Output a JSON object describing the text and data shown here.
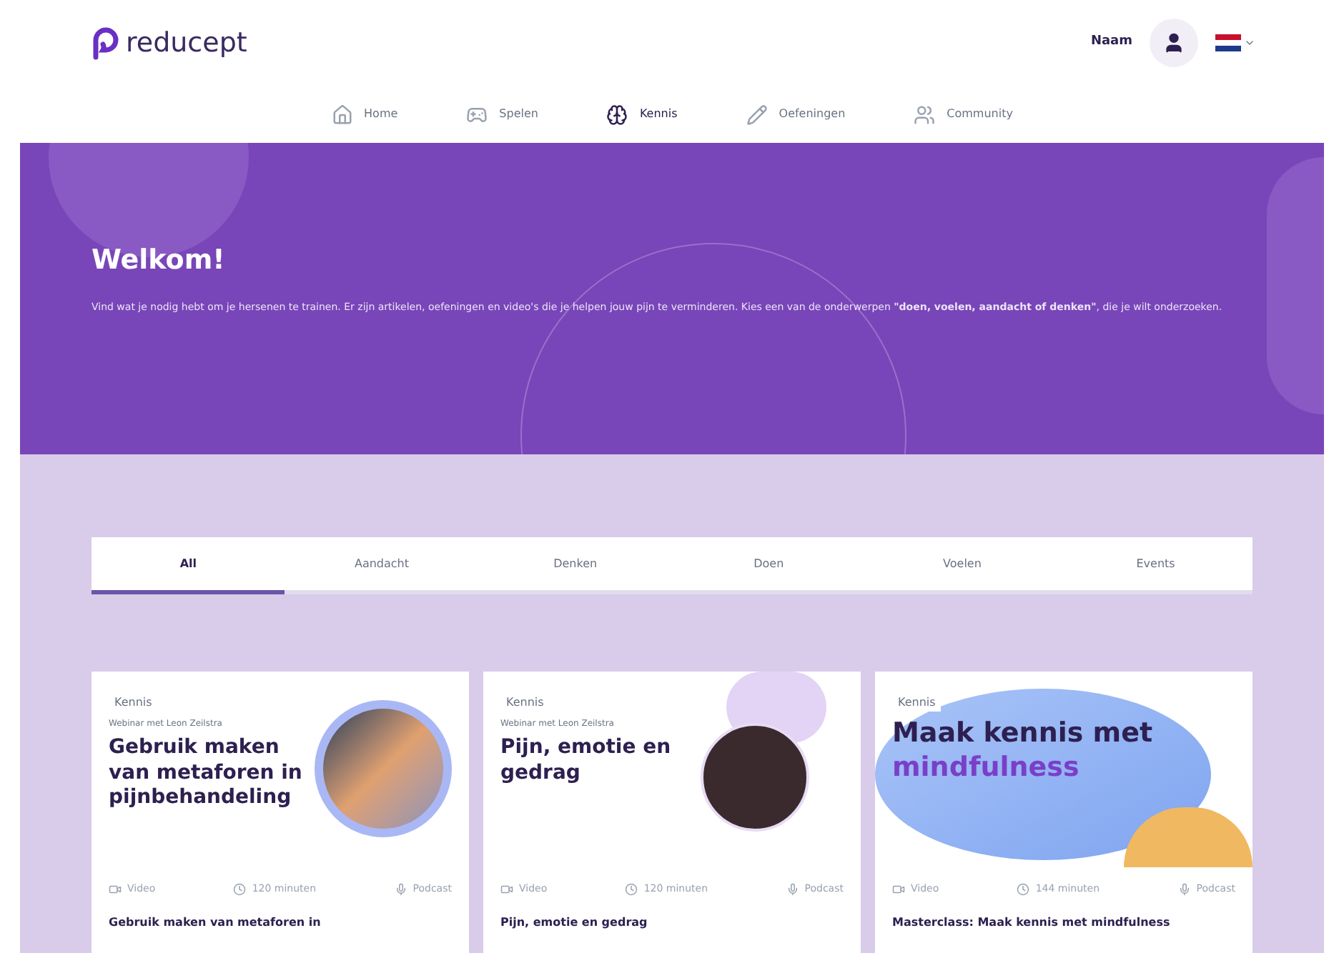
{
  "header": {
    "logo": "reducept",
    "user_name": "Naam"
  },
  "nav": [
    {
      "label": "Home",
      "selected": false
    },
    {
      "label": "Spelen",
      "selected": false
    },
    {
      "label": "Kennis",
      "selected": true
    },
    {
      "label": "Oefeningen",
      "selected": false
    },
    {
      "label": "Community",
      "selected": false
    }
  ],
  "hero": {
    "title": "Welkom!",
    "text": "Vind wat je nodig hebt om je hersenen te trainen. Er zijn artikelen, oefeningen en video's die je helpen jouw pijn te verminderen. Kies een van de onderwerpen **\"doen, voelen, aandacht of denken\"**, die je wilt onderzoeken."
  },
  "tabs": [
    {
      "label": "All",
      "selected": true
    },
    {
      "label": "Aandacht",
      "selected": false
    },
    {
      "label": "Denken",
      "selected": false
    },
    {
      "label": "Doen",
      "selected": false
    },
    {
      "label": "Voelen",
      "selected": false
    },
    {
      "label": "Events",
      "selected": false
    }
  ],
  "cards": [
    {
      "kind": "photo",
      "tag": "Kennis",
      "subtitle": "Webinar met Leon Zeilstra",
      "title": "Gebruik maken van metaforen in pijnbehandeling",
      "meta": [
        "Video",
        "120 minuten",
        "Podcast"
      ],
      "caption": "Gebruik maken van metaforen in"
    },
    {
      "kind": "portrait",
      "tag": "Kennis",
      "subtitle": "Webinar met Leon Zeilstra",
      "title": "Pijn, emotie en gedrag",
      "meta": [
        "Video",
        "120 minuten",
        "Podcast"
      ],
      "caption": "Pijn, emotie en gedrag"
    },
    {
      "kind": "blob",
      "tag": "Kennis",
      "title": "Maak kennis met",
      "title_accent": "mindfulness",
      "meta": [
        "Video",
        "144 minuten",
        "Podcast"
      ],
      "caption": "Masterclass: Maak kennis met mindfulness"
    }
  ]
}
